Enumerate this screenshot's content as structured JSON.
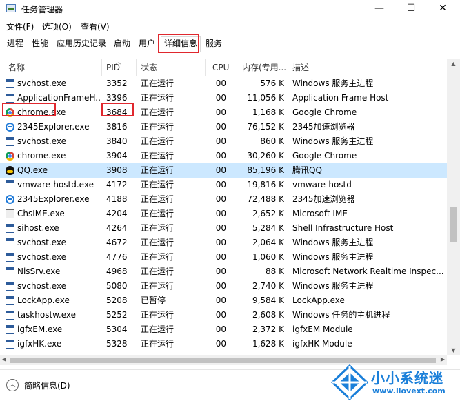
{
  "window": {
    "title": "任务管理器",
    "minimize_glyph": "—",
    "maximize_glyph": "☐",
    "close_glyph": "✕"
  },
  "menu": [
    "文件(F)",
    "选项(O)",
    "查看(V)"
  ],
  "tabs": [
    "进程",
    "性能",
    "应用历史记录",
    "启动",
    "用户",
    "详细信息",
    "服务"
  ],
  "active_tab": "详细信息",
  "columns": {
    "name": "名称",
    "pid": "PID",
    "status": "状态",
    "cpu": "CPU",
    "memory": "内存(专用...",
    "description": "描述"
  },
  "rows": [
    {
      "name": "svchost.exe",
      "pid": "3352",
      "status": "正在运行",
      "cpu": "00",
      "mem": "576 K",
      "desc": "Windows 服务主进程",
      "icon": "window-icon"
    },
    {
      "name": "ApplicationFrameH...",
      "pid": "3396",
      "status": "正在运行",
      "cpu": "00",
      "mem": "11,056 K",
      "desc": "Application Frame Host",
      "icon": "window-icon"
    },
    {
      "name": "chrome.exe",
      "pid": "3684",
      "status": "正在运行",
      "cpu": "00",
      "mem": "1,168 K",
      "desc": "Google Chrome",
      "icon": "chrome-icon"
    },
    {
      "name": "2345Explorer.exe",
      "pid": "3816",
      "status": "正在运行",
      "cpu": "00",
      "mem": "76,152 K",
      "desc": "2345加速浏览器",
      "icon": "browser-e-icon"
    },
    {
      "name": "svchost.exe",
      "pid": "3840",
      "status": "正在运行",
      "cpu": "00",
      "mem": "860 K",
      "desc": "Windows 服务主进程",
      "icon": "window-icon"
    },
    {
      "name": "chrome.exe",
      "pid": "3904",
      "status": "正在运行",
      "cpu": "00",
      "mem": "30,260 K",
      "desc": "Google Chrome",
      "icon": "chrome-icon"
    },
    {
      "name": "QQ.exe",
      "pid": "3908",
      "status": "正在运行",
      "cpu": "00",
      "mem": "85,196 K",
      "desc": "腾讯QQ",
      "icon": "qq-penguin-icon",
      "selected": true
    },
    {
      "name": "vmware-hostd.exe",
      "pid": "4172",
      "status": "正在运行",
      "cpu": "00",
      "mem": "19,816 K",
      "desc": "vmware-hostd",
      "icon": "window-icon"
    },
    {
      "name": "2345Explorer.exe",
      "pid": "4188",
      "status": "正在运行",
      "cpu": "00",
      "mem": "72,488 K",
      "desc": "2345加速浏览器",
      "icon": "browser-e-icon"
    },
    {
      "name": "ChsIME.exe",
      "pid": "4204",
      "status": "正在运行",
      "cpu": "00",
      "mem": "2,652 K",
      "desc": "Microsoft IME",
      "icon": "ime-icon"
    },
    {
      "name": "sihost.exe",
      "pid": "4264",
      "status": "正在运行",
      "cpu": "00",
      "mem": "5,284 K",
      "desc": "Shell Infrastructure Host",
      "icon": "window-icon"
    },
    {
      "name": "svchost.exe",
      "pid": "4672",
      "status": "正在运行",
      "cpu": "00",
      "mem": "2,064 K",
      "desc": "Windows 服务主进程",
      "icon": "window-icon"
    },
    {
      "name": "svchost.exe",
      "pid": "4776",
      "status": "正在运行",
      "cpu": "00",
      "mem": "1,060 K",
      "desc": "Windows 服务主进程",
      "icon": "window-icon"
    },
    {
      "name": "NisSrv.exe",
      "pid": "4968",
      "status": "正在运行",
      "cpu": "00",
      "mem": "88 K",
      "desc": "Microsoft Network Realtime Inspec...",
      "icon": "window-icon"
    },
    {
      "name": "svchost.exe",
      "pid": "5080",
      "status": "正在运行",
      "cpu": "00",
      "mem": "2,740 K",
      "desc": "Windows 服务主进程",
      "icon": "window-icon"
    },
    {
      "name": "LockApp.exe",
      "pid": "5208",
      "status": "已暂停",
      "cpu": "00",
      "mem": "9,584 K",
      "desc": "LockApp.exe",
      "icon": "window-icon"
    },
    {
      "name": "taskhostw.exe",
      "pid": "5252",
      "status": "正在运行",
      "cpu": "00",
      "mem": "2,608 K",
      "desc": "Windows 任务的主机进程",
      "icon": "window-icon"
    },
    {
      "name": "igfxEM.exe",
      "pid": "5304",
      "status": "正在运行",
      "cpu": "00",
      "mem": "2,372 K",
      "desc": "igfxEM Module",
      "icon": "window-icon"
    },
    {
      "name": "igfxHK.exe",
      "pid": "5328",
      "status": "正在运行",
      "cpu": "00",
      "mem": "1,628 K",
      "desc": "igfxHK Module",
      "icon": "window-icon"
    }
  ],
  "footer": {
    "less_details": "简略信息(D)",
    "toggle_glyph": "︿"
  },
  "watermark": {
    "name": "小小系统迷",
    "url": "www.ilovext.com"
  },
  "colors": {
    "selected_row": "#cce8ff",
    "highlight_box": "#e0282e",
    "watermark_blue": "#1a7fd9"
  }
}
